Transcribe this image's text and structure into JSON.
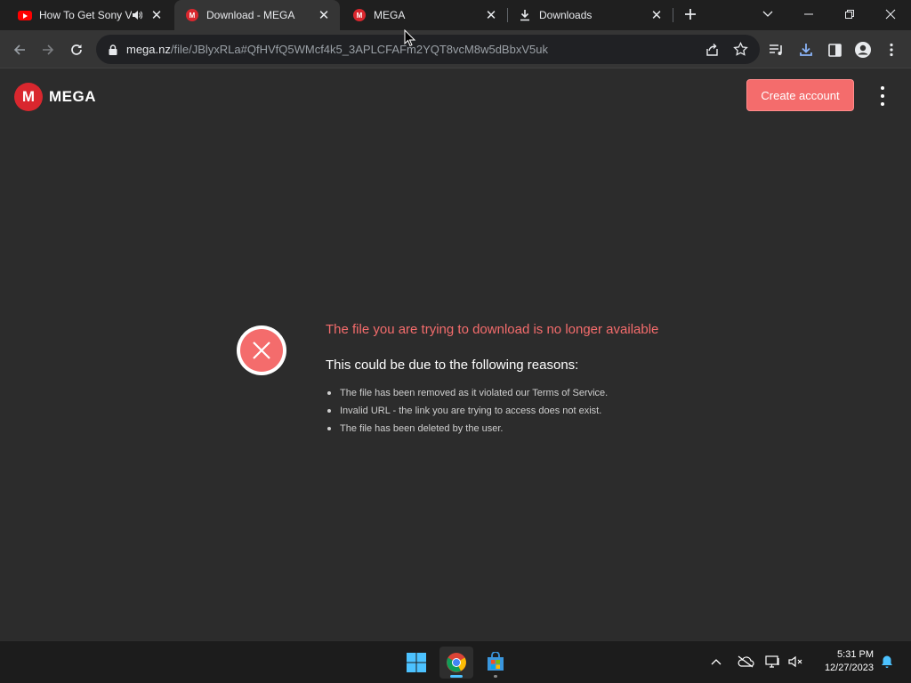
{
  "browser": {
    "tabs": [
      {
        "title": "How To Get Sony V",
        "favicon": "youtube-icon",
        "audio": true,
        "active": false
      },
      {
        "title": "Download - MEGA",
        "favicon": "mega-icon",
        "audio": false,
        "active": true
      },
      {
        "title": "MEGA",
        "favicon": "mega-icon",
        "audio": false,
        "active": false
      },
      {
        "title": "Downloads",
        "favicon": "download-icon",
        "audio": false,
        "active": false
      }
    ],
    "url_host": "mega.nz",
    "url_path": "/file/JBlyxRLa#QfHVfQ5WMcf4k5_3APLCFAFm2YQT8vcM8w5dBbxV5uk"
  },
  "page": {
    "logo_text": "MEGA",
    "logo_letter": "M",
    "create_account_label": "Create account",
    "error_title": "The file you are trying to download is no longer available",
    "reasons_heading": "This could be due to the following reasons:",
    "reasons": [
      "The file has been removed as it violated our Terms of Service.",
      "Invalid URL - the link you are trying to access does not exist.",
      "The file has been deleted by the user."
    ]
  },
  "taskbar": {
    "time": "5:31 PM",
    "date": "12/27/2023"
  },
  "colors": {
    "accent": "#f46c6c",
    "mega_red": "#d9272e",
    "page_bg": "#2c2c2c"
  }
}
